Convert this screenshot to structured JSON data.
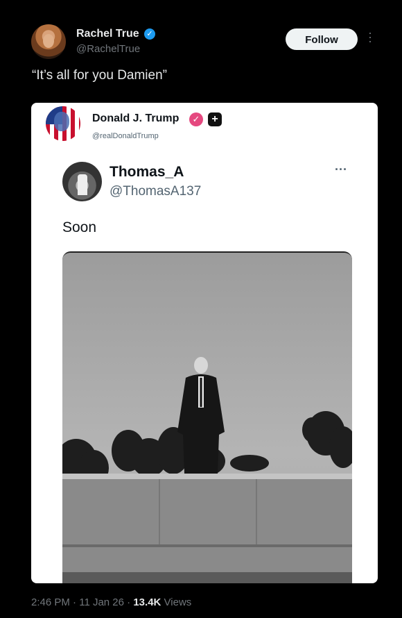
{
  "post": {
    "author_name": "Rachel True",
    "author_handle": "@RachelTrue",
    "follow_label": "Follow",
    "text": "“It’s all for you Damien”",
    "time": "2:46 PM",
    "date": "11 Jan 26",
    "views_count": "13.4K",
    "views_label": "Views",
    "separator": "·"
  },
  "embed": {
    "author_name": "Donald J. Trump",
    "author_handle": "@realDonaldTrump",
    "quoted": {
      "author_name": "Thomas_A",
      "author_handle": "@ThomasA137",
      "more": "···",
      "text": "Soon"
    }
  },
  "colors": {
    "background": "#000000",
    "verified": "#1d9bf0",
    "badge_pink": "#e5487f"
  },
  "icons": {
    "verified": "check-badge-icon",
    "more": "more-vertical-icon",
    "affiliate": "plus-badge-icon"
  }
}
